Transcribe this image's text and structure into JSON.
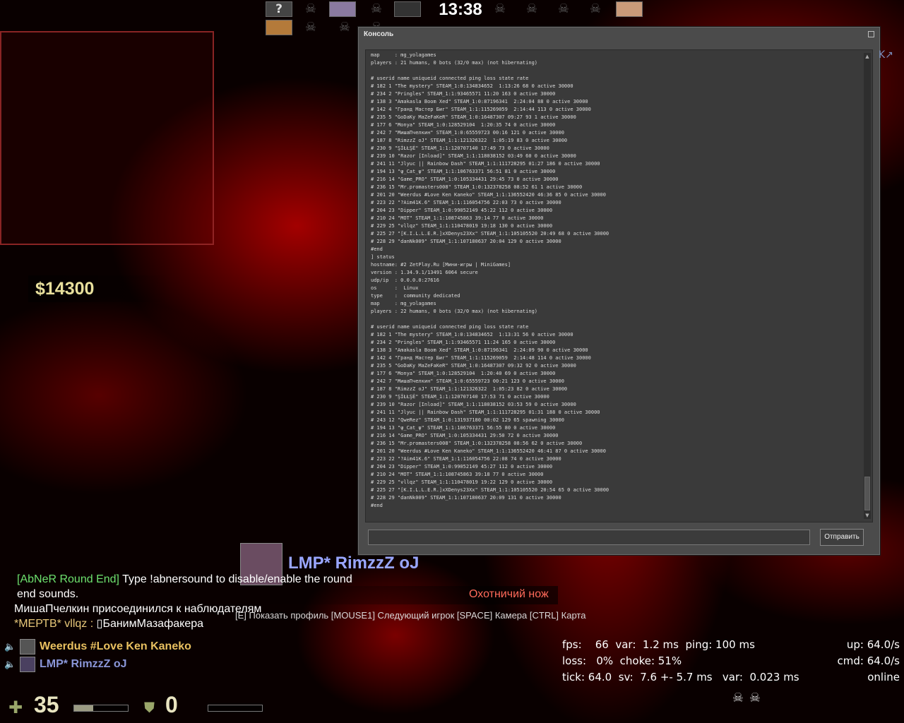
{
  "top_bar": {
    "timer": "13:38",
    "unknown_slot_label": "?"
  },
  "radar": {},
  "money": "$14300",
  "console": {
    "title": "Консоль",
    "send_label": "Отправить",
    "input_value": "",
    "lines": [
      "map     : mg_yolagames",
      "players : 21 humans, 0 bots (32/0 max) (not hibernating)",
      "",
      "# userid name uniqueid connected ping loss state rate",
      "# 182 1 \"The mystery\" STEAM_1:0:134834652  1:13:26 68 0 active 30000",
      "# 234 2 \"Pringles\" STEAM_1:1:93465571 11:20 163 0 active 30000",
      "# 138 3 \"Amakasla Boom Xed\" STEAM_1:0:87196341  2:24:04 88 0 active 30000",
      "# 142 4 \"Гранд Мастер Биг\" STEAM_1:1:115269059  2:14:44 113 0 active 30000",
      "# 235 5 \"GoDaKy MaZeFaKeR\" STEAM_1:0:16487307 09:27 93 1 active 30000",
      "# 177 6 \"Monya\" STEAM_1:0:128529104  1:20:35 74 0 active 30000",
      "# 242 7 \"МишаПчелкин\" STEAM_1:0:65559723 00:16 121 0 active 30000",
      "# 187 8 \"RimzzZ oJ\" STEAM_1:1:121326322  1:05:19 83 0 active 30000",
      "# 230 9 \"ŞİŁŁŞĖ\" STEAM_1:1:120707140 17:49 73 0 active 30000",
      "# 239 10 \"Razor [Inload]\" STEAM_1:1:118038152 03:49 60 0 active 30000",
      "# 241 11 \"Jlyuc || Rainbow Dash\" STEAM_1:1:111728295 01:27 186 0 active 30000",
      "# 194 13 \"ψ_Cat_ψ\" STEAM_1:1:106763371 56:51 81 0 active 30000",
      "# 216 14 \"Game_PRO\" STEAM_1:0:105334431 29:45 73 0 active 30000",
      "# 236 15 \"Mr.promasters008\" STEAM_1:0:132378258 08:52 61 1 active 30000",
      "# 201 20 \"Weerdus #Love Ken Kaneko\" STEAM_1:1:136552420 46:36 85 0 active 30000",
      "# 223 22 \"?Aim41K.6\" STEAM_1:1:116054756 22:03 73 0 active 30000",
      "# 204 23 \"Dipper\" STEAM_1:0:99052149 45:22 112 0 active 30000",
      "# 210 24 \"MOT\" STEAM_1:1:108745863 39:14 77 0 active 30000",
      "# 229 25 \"vllqz\" STEAM_1:1:110478019 19:18 130 0 active 30000",
      "# 225 27 \"[K.I.L.L.E.R.]xXDenys23Xx\" STEAM_1:1:105105520 20:49 68 0 active 30000",
      "# 228 29 \"danNk009\" STEAM_1:1:107180637 20:04 129 0 active 30000",
      "#end",
      "] status",
      "hostname: #2 ZetPlay.Ru [Мини-игры | MiniGames]",
      "version : 1.34.9.1/13491 6064 secure",
      "udp/ip  : 0.0.0.0:27616",
      "os      :  Linux",
      "type    :  community dedicated",
      "map     : mg_yolagames",
      "players : 22 humans, 0 bots (32/0 max) (not hibernating)",
      "",
      "# userid name uniqueid connected ping loss state rate",
      "# 182 1 \"The mystery\" STEAM_1:0:134834652  1:13:31 56 0 active 30000",
      "# 234 2 \"Pringles\" STEAM_1:1:93465571 11:24 165 0 active 30000",
      "# 138 3 \"Amakasla Boom Xed\" STEAM_1:0:87196341  2:24:09 90 0 active 30000",
      "# 142 4 \"Гранд Мастер Биг\" STEAM_1:1:115269059  2:14:48 114 0 active 30000",
      "# 235 5 \"GoDaKy MaZeFaKeR\" STEAM_1:0:16487307 09:32 92 0 active 30000",
      "# 177 6 \"Monya\" STEAM_1:0:128529104  1:20:40 69 0 active 30000",
      "# 242 7 \"МишаПчелкин\" STEAM_1:0:65559723 00:21 123 0 active 30000",
      "# 187 8 \"RimzzZ oJ\" STEAM_1:1:121326322  1:05:23 82 0 active 30000",
      "# 230 9 \"ŞİŁŁŞĖ\" STEAM_1:1:120707140 17:53 71 0 active 30000",
      "# 239 10 \"Razor [Inload]\" STEAM_1:1:118038152 03:53 59 0 active 30000",
      "# 241 11 \"Jlyuc || Rainbow Dash\" STEAM_1:1:111728295 01:31 188 0 active 30000",
      "# 243 12 \"QweRez\" STEAM_1:0:131937180 00:02 129 65 spawning 30000",
      "# 194 13 \"ψ_Cat_ψ\" STEAM_1:1:106763371 56:55 80 0 active 30000",
      "# 216 14 \"Game_PRO\" STEAM_1:0:105334431 29:50 72 0 active 30000",
      "# 236 15 \"Mr.promasters008\" STEAM_1:0:132378258 08:56 62 0 active 30000",
      "# 201 20 \"Weerdus #Love Ken Kaneko\" STEAM_1:1:136552420 46:41 87 0 active 30000",
      "# 223 22 \"?Aim41K.6\" STEAM_1:1:116054756 22:08 74 0 active 30000",
      "# 204 23 \"Dipper\" STEAM_1:0:99052149 45:27 112 0 active 30000",
      "# 210 24 \"MOT\" STEAM_1:1:108745863 39:18 77 0 active 30000",
      "# 229 25 \"vllqz\" STEAM_1:1:110478019 19:22 129 0 active 30000",
      "# 225 27 \"[K.I.L.L.E.R.]xXDenys23Xx\" STEAM_1:1:105105520 20:54 65 0 active 30000",
      "# 228 29 \"danNk009\" STEAM_1:1:107180637 20:09 131 0 active 30000",
      "#end"
    ]
  },
  "side_mark": "K↗",
  "spectate": {
    "player_name": "LMP* RimzzZ oJ",
    "weapon": "Охотничий нож",
    "hint": "[E] Показать профиль [MOUSE1] Следующий игрок [SPACE] Камера [CTRL] Карта"
  },
  "chat": {
    "line1_tag": "[AbNeR Round End]",
    "line1_text": " Type !abnersound to disable/enable the round end sounds.",
    "line2": "МишаПчелкин присоединился к наблюдателям",
    "line3_prefix": "*МЕРТВ* vllqz : ",
    "line3_text": "▯БанимМазафакера"
  },
  "voice": [
    {
      "name": "Weerdus #Love Ken Kaneko",
      "color": "#e8c060"
    },
    {
      "name": "LMP* RimzzZ oJ",
      "color": "#8a96d8"
    }
  ],
  "netgraph": {
    "line1": "fps:    66  var:  1.2 ms  ping: 100 ms",
    "line2": "loss:   0%  choke: 51%",
    "line3": "tick: 64.0  sv:  7.6 +- 5.7 ms   var:  0.023 ms",
    "right1": "up: 64.0/s",
    "right2": "cmd: 64.0/s",
    "right3": "online"
  },
  "hud": {
    "health": "35",
    "health_fraction": 0.35,
    "armor": "0",
    "armor_fraction": 0
  },
  "icons": {
    "skull": "skull-icon",
    "speaker": "speaker-icon",
    "health": "health-cross-icon",
    "armor": "shield-icon"
  }
}
